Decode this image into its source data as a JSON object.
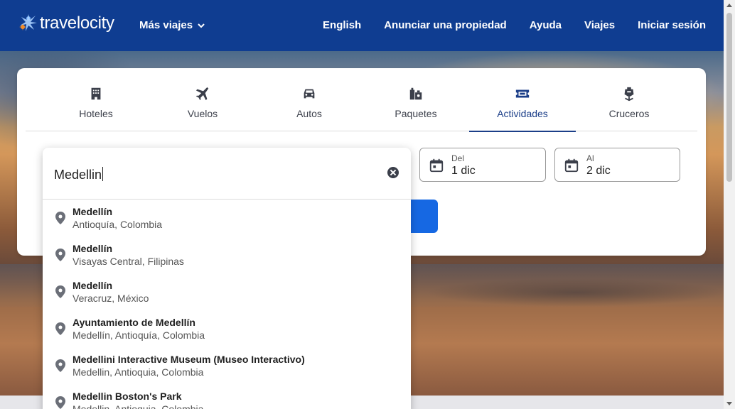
{
  "header": {
    "logo_text": "travelocity",
    "more_trips": "Más viajes",
    "nav": [
      "English",
      "Anunciar una propiedad",
      "Ayuda",
      "Viajes",
      "Iniciar sesión"
    ]
  },
  "tabs": [
    {
      "label": "Hoteles",
      "icon": "hotel-icon"
    },
    {
      "label": "Vuelos",
      "icon": "plane-icon"
    },
    {
      "label": "Autos",
      "icon": "car-icon"
    },
    {
      "label": "Paquetes",
      "icon": "package-icon"
    },
    {
      "label": "Actividades",
      "icon": "ticket-icon",
      "active": true
    },
    {
      "label": "Cruceros",
      "icon": "cruise-icon"
    }
  ],
  "search": {
    "value": "Medellin",
    "from_label": "Del",
    "from_value": "1 dic",
    "to_label": "Al",
    "to_value": "2 dic"
  },
  "suggestions": [
    {
      "title": "Medellín",
      "subtitle": "Antioquía, Colombia"
    },
    {
      "title": "Medellín",
      "subtitle": "Visayas Central, Filipinas"
    },
    {
      "title": "Medellín",
      "subtitle": "Veracruz, México"
    },
    {
      "title": "Ayuntamiento de Medellín",
      "subtitle": "Medellín, Antioquía, Colombia"
    },
    {
      "title": "Medellini Interactive Museum (Museo Interactivo)",
      "subtitle": "Medellin, Antioquia, Colombia"
    },
    {
      "title": "Medellin Boston's Park",
      "subtitle": "Medellin, Antioquia, Colombia"
    }
  ],
  "colors": {
    "header_bg": "#0f3d91",
    "accent": "#1b3e88",
    "button": "#1668e3"
  }
}
